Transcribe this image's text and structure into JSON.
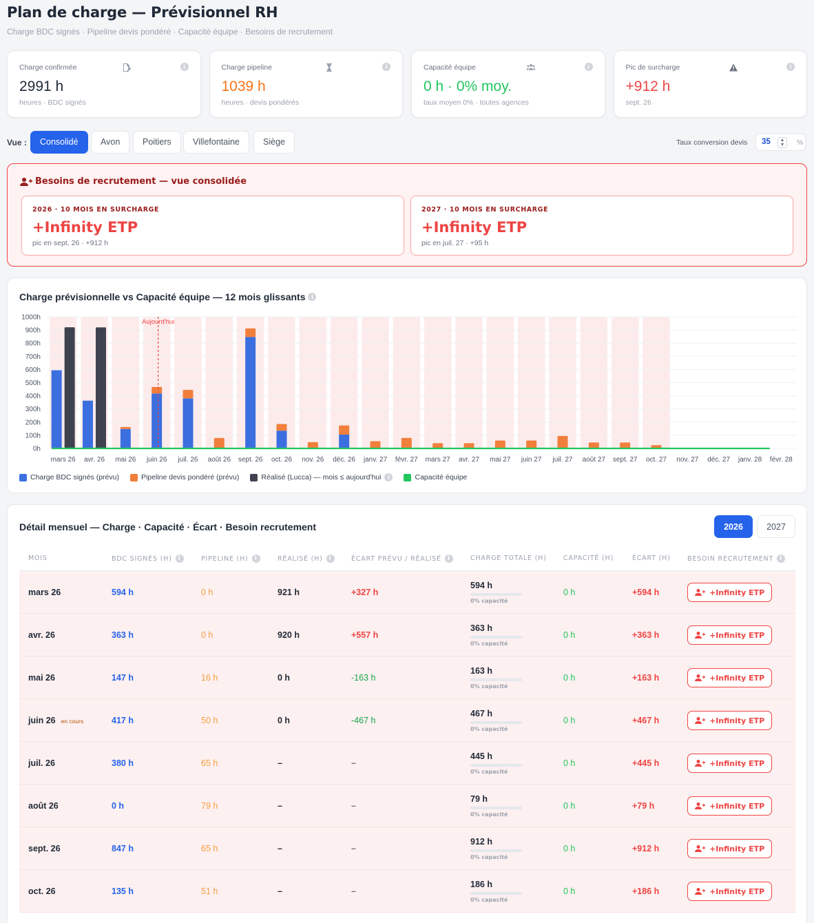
{
  "header": {
    "title": "Plan de charge — Prévisionnel RH",
    "subtitle": "Charge BDC signés · Pipeline devis pondéré · Capacité équipe · Besoins de recrutement"
  },
  "kpis": [
    {
      "label": "Charge confirmée",
      "icon": "file-signature-icon",
      "value": "2991 h",
      "sub": "heures · BDC signés",
      "color": "#1f2937"
    },
    {
      "label": "Charge pipeline",
      "icon": "hourglass-icon",
      "value": "1039 h",
      "sub": "heures · devis pondérés",
      "color": "#f97316"
    },
    {
      "label": "Capacité équipe",
      "icon": "users-icon",
      "value": "0 h · 0% moy.",
      "sub": "taux moyen 0% · toutes agences",
      "color": "#22c55e"
    },
    {
      "label": "Pic de surcharge",
      "icon": "warning-icon",
      "value": "+912 h",
      "sub": "sept. 26",
      "color": "#ef4444"
    }
  ],
  "views": {
    "label": "Vue :",
    "items": [
      "Consolidé",
      "Avon",
      "Poitiers",
      "Villefontaine",
      "Siège"
    ],
    "active": 0,
    "conversion_label": "Taux conversion devis",
    "conversion_value": "35",
    "conversion_unit": "%"
  },
  "recruitment": {
    "title": "Besoins de recrutement — vue consolidée",
    "cards": [
      {
        "caption": "2026 · 10 MOIS EN SURCHARGE",
        "value": "+Infinity ETP",
        "sub": "pic en sept. 26 · +912 h"
      },
      {
        "caption": "2027 · 10 MOIS EN SURCHARGE",
        "value": "+Infinity ETP",
        "sub": "pic en juil. 27 · +95 h"
      }
    ]
  },
  "chart": {
    "title": "Charge prévisionnelle vs Capacité équipe — 12 mois glissants",
    "today_label": "Aujourd'hui",
    "legend": [
      "Charge BDC signés (prévu)",
      "Pipeline devis pondéré (prévu)",
      "Réalisé (Lucca) — mois ≤ aujourd'hui",
      "Capacité équipe"
    ]
  },
  "chart_data": {
    "type": "bar",
    "title": "Charge prévisionnelle vs Capacité équipe — 12 mois glissants",
    "categories": [
      "mars 26",
      "avr. 26",
      "mai 26",
      "juin 26",
      "juil. 26",
      "août 26",
      "sept. 26",
      "oct. 26",
      "nov. 26",
      "déc. 26",
      "janv. 27",
      "févr. 27",
      "mars 27",
      "avr. 27",
      "mai 27",
      "juin 27",
      "juil. 27",
      "août 27",
      "sept. 27",
      "oct. 27",
      "nov. 27",
      "déc. 27",
      "janv. 28",
      "févr. 28"
    ],
    "y_ticks": [
      "0h",
      "100h",
      "200h",
      "300h",
      "400h",
      "500h",
      "600h",
      "700h",
      "800h",
      "900h",
      "1000h"
    ],
    "ylim": [
      0,
      1000
    ],
    "today_index": 3,
    "series": [
      {
        "name": "Charge BDC signés (prévu)",
        "color": "#3b6fe0",
        "stack": "prevu",
        "values": [
          594,
          363,
          147,
          417,
          380,
          0,
          847,
          135,
          0,
          105,
          0,
          0,
          0,
          0,
          0,
          0,
          0,
          0,
          0,
          0,
          0,
          0,
          0,
          0
        ]
      },
      {
        "name": "Pipeline devis pondéré (prévu)",
        "color": "#f07f3c",
        "stack": "prevu",
        "values": [
          0,
          0,
          16,
          50,
          65,
          79,
          65,
          51,
          48,
          70,
          55,
          80,
          40,
          40,
          60,
          60,
          95,
          45,
          45,
          25,
          0,
          0,
          0,
          0
        ]
      },
      {
        "name": "Réalisé (Lucca) — mois ≤ aujourd'hui",
        "color": "#3f4350",
        "stack": "realise",
        "values": [
          921,
          920,
          null,
          null,
          null,
          null,
          null,
          null,
          null,
          null,
          null,
          null,
          null,
          null,
          null,
          null,
          null,
          null,
          null,
          null,
          null,
          null,
          null,
          null
        ]
      },
      {
        "name": "Capacité équipe",
        "color": "#22c55e",
        "type": "line",
        "values": [
          0,
          0,
          0,
          0,
          0,
          0,
          0,
          0,
          0,
          0,
          0,
          0,
          0,
          0,
          0,
          0,
          0,
          0,
          0,
          0,
          0,
          0,
          0,
          0
        ]
      }
    ],
    "overload_months": 20,
    "legend_position": "bottom-left",
    "grid": true
  },
  "table": {
    "title": "Détail mensuel — Charge · Capacité · Écart · Besoin recrutement",
    "years": [
      "2026",
      "2027"
    ],
    "active_year": 0,
    "headers": [
      "MOIS",
      "BDC SIGNÉS (H)",
      "PIPELINE (H)",
      "RÉALISÉ (H)",
      "ÉCART PRÉVU / RÉALISÉ",
      "CHARGE TOTALE (H)",
      "CAPACITÉ (H)",
      "ÉCART (H)",
      "BESOIN RECRUTEMENT"
    ],
    "rows": [
      {
        "mois": "mars 26",
        "tag": "",
        "bdc": "594 h",
        "pipeline": "0 h",
        "realise": "921 h",
        "ecart_pr": "+327 h",
        "ecart_kind": "pos",
        "total": "594 h",
        "total_sub": "0% capacité",
        "capacite": "0 h",
        "ecart": "+594 h",
        "besoin": "+Infinity ETP"
      },
      {
        "mois": "avr. 26",
        "tag": "",
        "bdc": "363 h",
        "pipeline": "0 h",
        "realise": "920 h",
        "ecart_pr": "+557 h",
        "ecart_kind": "pos",
        "total": "363 h",
        "total_sub": "0% capacité",
        "capacite": "0 h",
        "ecart": "+363 h",
        "besoin": "+Infinity ETP"
      },
      {
        "mois": "mai 26",
        "tag": "",
        "bdc": "147 h",
        "pipeline": "16 h",
        "realise": "0 h",
        "ecart_pr": "-163 h",
        "ecart_kind": "neg",
        "total": "163 h",
        "total_sub": "0% capacité",
        "capacite": "0 h",
        "ecart": "+163 h",
        "besoin": "+Infinity ETP"
      },
      {
        "mois": "juin 26",
        "tag": "en cours",
        "bdc": "417 h",
        "pipeline": "50 h",
        "realise": "0 h",
        "ecart_pr": "-467 h",
        "ecart_kind": "neg",
        "total": "467 h",
        "total_sub": "0% capacité",
        "capacite": "0 h",
        "ecart": "+467 h",
        "besoin": "+Infinity ETP"
      },
      {
        "mois": "juil. 26",
        "tag": "",
        "bdc": "380 h",
        "pipeline": "65 h",
        "realise": "–",
        "ecart_pr": "–",
        "ecart_kind": "none",
        "total": "445 h",
        "total_sub": "0% capacité",
        "capacite": "0 h",
        "ecart": "+445 h",
        "besoin": "+Infinity ETP"
      },
      {
        "mois": "août 26",
        "tag": "",
        "bdc": "0 h",
        "pipeline": "79 h",
        "realise": "–",
        "ecart_pr": "–",
        "ecart_kind": "none",
        "total": "79 h",
        "total_sub": "0% capacité",
        "capacite": "0 h",
        "ecart": "+79 h",
        "besoin": "+Infinity ETP"
      },
      {
        "mois": "sept. 26",
        "tag": "",
        "bdc": "847 h",
        "pipeline": "65 h",
        "realise": "–",
        "ecart_pr": "–",
        "ecart_kind": "none",
        "total": "912 h",
        "total_sub": "0% capacité",
        "capacite": "0 h",
        "ecart": "+912 h",
        "besoin": "+Infinity ETP"
      },
      {
        "mois": "oct. 26",
        "tag": "",
        "bdc": "135 h",
        "pipeline": "51 h",
        "realise": "–",
        "ecart_pr": "–",
        "ecart_kind": "none",
        "total": "186 h",
        "total_sub": "0% capacité",
        "capacite": "0 h",
        "ecart": "+186 h",
        "besoin": "+Infinity ETP"
      }
    ]
  }
}
